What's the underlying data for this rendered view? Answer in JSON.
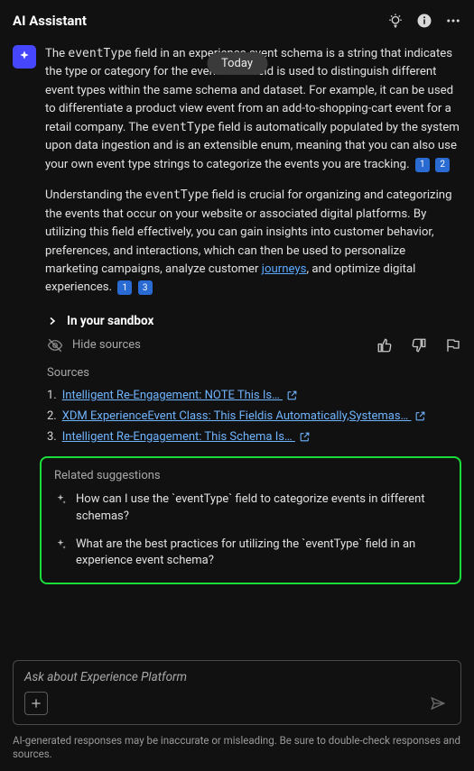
{
  "header": {
    "title": "AI Assistant"
  },
  "day_label": "Today",
  "message": {
    "p1_a": "The ",
    "p1_code1": "eventType",
    "p1_b": " field in an experience event schema is a string that indicates the type or category for the event. This field is used to distinguish different event types within the same schema and dataset. For example, it can be used to differentiate a product view event from an add-to-shopping-cart event for a retail company. The ",
    "p1_code2": "eventType",
    "p1_c": " field is automatically populated by the system upon data ingestion and is an extensible enum, meaning that you can also use your own event type strings to categorize the events you are tracking.",
    "cite1": "1",
    "cite2": "2",
    "p2_a": "Understanding the ",
    "p2_code1": "eventType",
    "p2_b": " field is crucial for organizing and categorizing the events that occur on your website or associated digital platforms. By utilizing this field effectively, you can gain insights into customer behavior, preferences, and interactions, which can then be used to personalize marketing campaigns, analyze customer ",
    "p2_link": "journeys",
    "p2_c": ", and optimize digital experiences.",
    "cite3": "1",
    "cite4": "3"
  },
  "sandbox_label": "In your sandbox",
  "hide_sources_label": "Hide sources",
  "sources": {
    "title": "Sources",
    "items": [
      {
        "n": "1.",
        "text": "Intelligent Re-Engagement: NOTE This Is… "
      },
      {
        "n": "2.",
        "text": "XDM ExperienceEvent Class: This Fieldis Automatically,Systemas… "
      },
      {
        "n": "3.",
        "text": "Intelligent Re-Engagement: This Schema Is… "
      }
    ]
  },
  "related": {
    "title": "Related suggestions",
    "items": [
      "How can I use the `eventType` field to categorize events in different schemas?",
      "What are the best practices for utilizing the `eventType` field in an experience event schema?"
    ]
  },
  "input": {
    "placeholder": "Ask about Experience Platform"
  },
  "disclaimer": "AI-generated responses may be inaccurate or misleading. Be sure to double-check responses and sources."
}
